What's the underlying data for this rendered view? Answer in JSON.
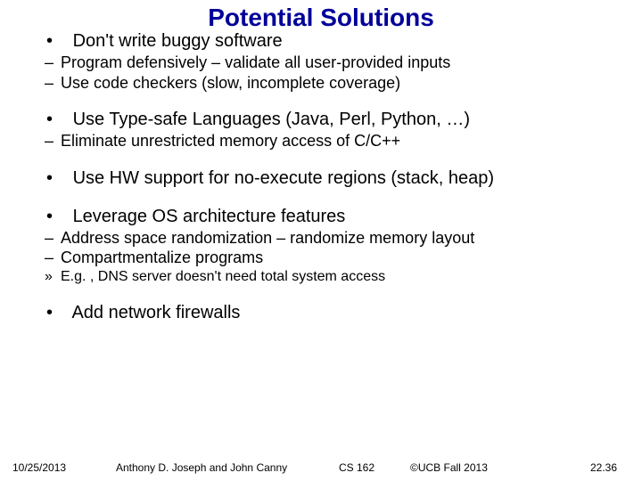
{
  "title": "Potential Solutions",
  "bullets": [
    {
      "text": "Don't write buggy software",
      "sub": [
        "Program defensively – validate all user-provided inputs",
        "Use code checkers (slow, incomplete coverage)"
      ]
    },
    {
      "text": "Use Type-safe Languages (Java, Perl, Python, …)",
      "sub": [
        "Eliminate unrestricted memory access of C/C++"
      ]
    },
    {
      "text": "Use HW support for no-execute regions (stack, heap)",
      "sub": []
    },
    {
      "text": "Leverage OS architecture features",
      "sub": [
        "Address space randomization – randomize memory layout",
        "Compartmentalize programs"
      ],
      "subsub": [
        "E.g. , DNS server doesn't need total system access"
      ]
    },
    {
      "text": "Add network firewalls",
      "sub": []
    }
  ],
  "footer": {
    "date": "10/25/2013",
    "author": "Anthony D. Joseph and John Canny",
    "course": "CS 162",
    "copyright": "©UCB Fall 2013",
    "page": "22.36"
  }
}
